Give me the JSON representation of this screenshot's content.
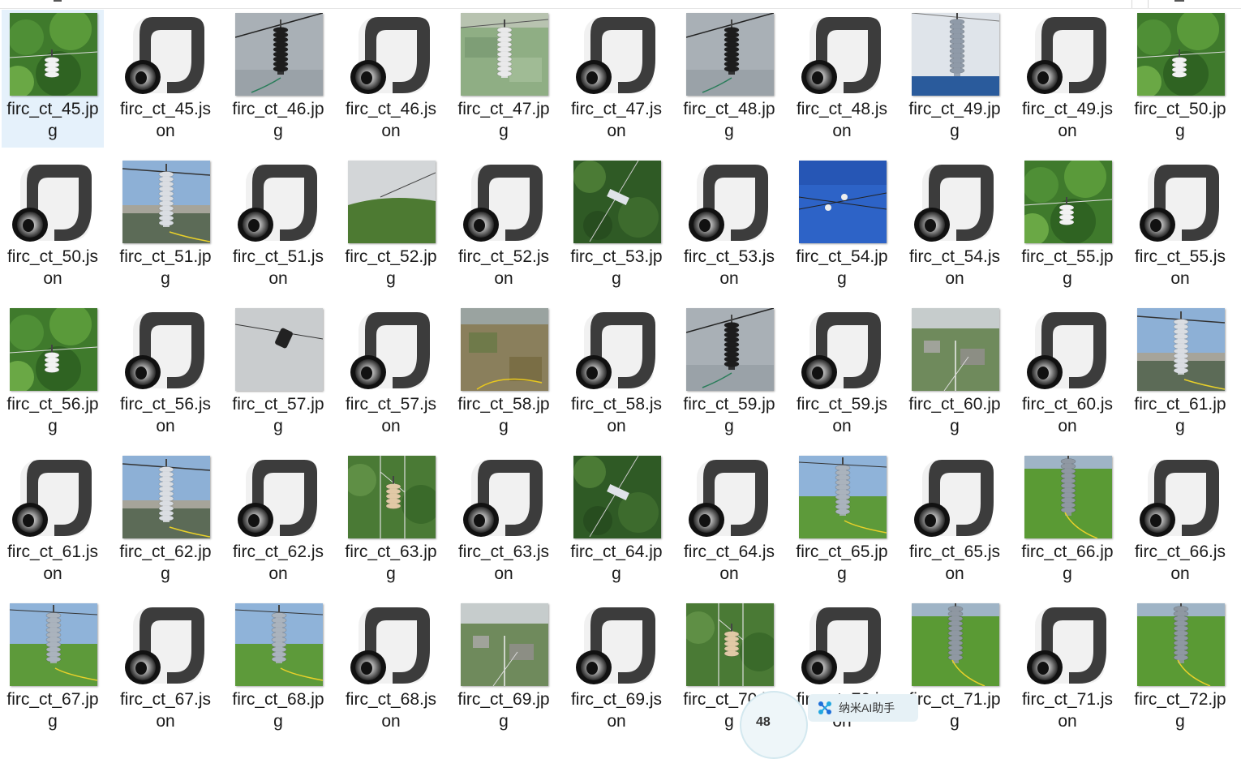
{
  "window": {
    "top_marks": [
      {
        "kind": "tab-mark"
      }
    ]
  },
  "files": [
    {
      "name": "firc_ct_45.jpg",
      "type": "image",
      "scene": "jungle",
      "selected": true
    },
    {
      "name": "firc_ct_45.json",
      "type": "json"
    },
    {
      "name": "firc_ct_46.jpg",
      "type": "image",
      "scene": "sky-black"
    },
    {
      "name": "firc_ct_46.json",
      "type": "json"
    },
    {
      "name": "firc_ct_47.jpg",
      "type": "image",
      "scene": "field-white"
    },
    {
      "name": "firc_ct_47.json",
      "type": "json"
    },
    {
      "name": "firc_ct_48.jpg",
      "type": "image",
      "scene": "sky-black"
    },
    {
      "name": "firc_ct_48.json",
      "type": "json"
    },
    {
      "name": "firc_ct_49.jpg",
      "type": "image",
      "scene": "sky-tower"
    },
    {
      "name": "firc_ct_49.json",
      "type": "json"
    },
    {
      "name": "firc_ct_50.jpg",
      "type": "image",
      "scene": "jungle"
    },
    {
      "name": "firc_ct_50.json",
      "type": "json"
    },
    {
      "name": "firc_ct_51.jpg",
      "type": "image",
      "scene": "sky-blue-white"
    },
    {
      "name": "firc_ct_51.json",
      "type": "json"
    },
    {
      "name": "firc_ct_52.jpg",
      "type": "image",
      "scene": "hill"
    },
    {
      "name": "firc_ct_52.json",
      "type": "json"
    },
    {
      "name": "firc_ct_53.jpg",
      "type": "image",
      "scene": "forest"
    },
    {
      "name": "firc_ct_53.json",
      "type": "json"
    },
    {
      "name": "firc_ct_54.jpg",
      "type": "image",
      "scene": "blue-sky"
    },
    {
      "name": "firc_ct_54.json",
      "type": "json"
    },
    {
      "name": "firc_ct_55.jpg",
      "type": "image",
      "scene": "jungle"
    },
    {
      "name": "firc_ct_55.json",
      "type": "json"
    },
    {
      "name": "firc_ct_56.jpg",
      "type": "image",
      "scene": "jungle"
    },
    {
      "name": "firc_ct_56.json",
      "type": "json"
    },
    {
      "name": "firc_ct_57.jpg",
      "type": "image",
      "scene": "grey-sky"
    },
    {
      "name": "firc_ct_57.json",
      "type": "json"
    },
    {
      "name": "firc_ct_58.jpg",
      "type": "image",
      "scene": "fields-brown"
    },
    {
      "name": "firc_ct_58.json",
      "type": "json"
    },
    {
      "name": "firc_ct_59.jpg",
      "type": "image",
      "scene": "sky-black"
    },
    {
      "name": "firc_ct_59.json",
      "type": "json"
    },
    {
      "name": "firc_ct_60.jpg",
      "type": "image",
      "scene": "town"
    },
    {
      "name": "firc_ct_60.json",
      "type": "json"
    },
    {
      "name": "firc_ct_61.jpg",
      "type": "image",
      "scene": "sky-blue-white"
    },
    {
      "name": "firc_ct_61.json",
      "type": "json"
    },
    {
      "name": "firc_ct_62.jpg",
      "type": "image",
      "scene": "sky-blue-white"
    },
    {
      "name": "firc_ct_62.json",
      "type": "json"
    },
    {
      "name": "firc_ct_63.jpg",
      "type": "image",
      "scene": "forest-tower"
    },
    {
      "name": "firc_ct_63.json",
      "type": "json"
    },
    {
      "name": "firc_ct_64.jpg",
      "type": "image",
      "scene": "forest"
    },
    {
      "name": "firc_ct_64.json",
      "type": "json"
    },
    {
      "name": "firc_ct_65.jpg",
      "type": "image",
      "scene": "sky-green"
    },
    {
      "name": "firc_ct_65.json",
      "type": "json"
    },
    {
      "name": "firc_ct_66.jpg",
      "type": "image",
      "scene": "green-field"
    },
    {
      "name": "firc_ct_66.json",
      "type": "json"
    },
    {
      "name": "firc_ct_67.jpg",
      "type": "image",
      "scene": "sky-green"
    },
    {
      "name": "firc_ct_67.json",
      "type": "json"
    },
    {
      "name": "firc_ct_68.jpg",
      "type": "image",
      "scene": "sky-green"
    },
    {
      "name": "firc_ct_68.json",
      "type": "json"
    },
    {
      "name": "firc_ct_69.jpg",
      "type": "image",
      "scene": "town"
    },
    {
      "name": "firc_ct_69.json",
      "type": "json"
    },
    {
      "name": "firc_ct_70.jpg",
      "type": "image",
      "scene": "forest-tower"
    },
    {
      "name": "firc_ct_70.json",
      "type": "json"
    },
    {
      "name": "firc_ct_71.jpg",
      "type": "image",
      "scene": "green-field"
    },
    {
      "name": "firc_ct_71.json",
      "type": "json"
    },
    {
      "name": "firc_ct_72.jpg",
      "type": "image",
      "scene": "green-field"
    }
  ],
  "assistant": {
    "count": "48",
    "label": "纳米AI助手",
    "icon": "ai-assistant-icon"
  },
  "colors": {
    "selection": "#e5f1fb",
    "text": "#1a1a1a"
  }
}
